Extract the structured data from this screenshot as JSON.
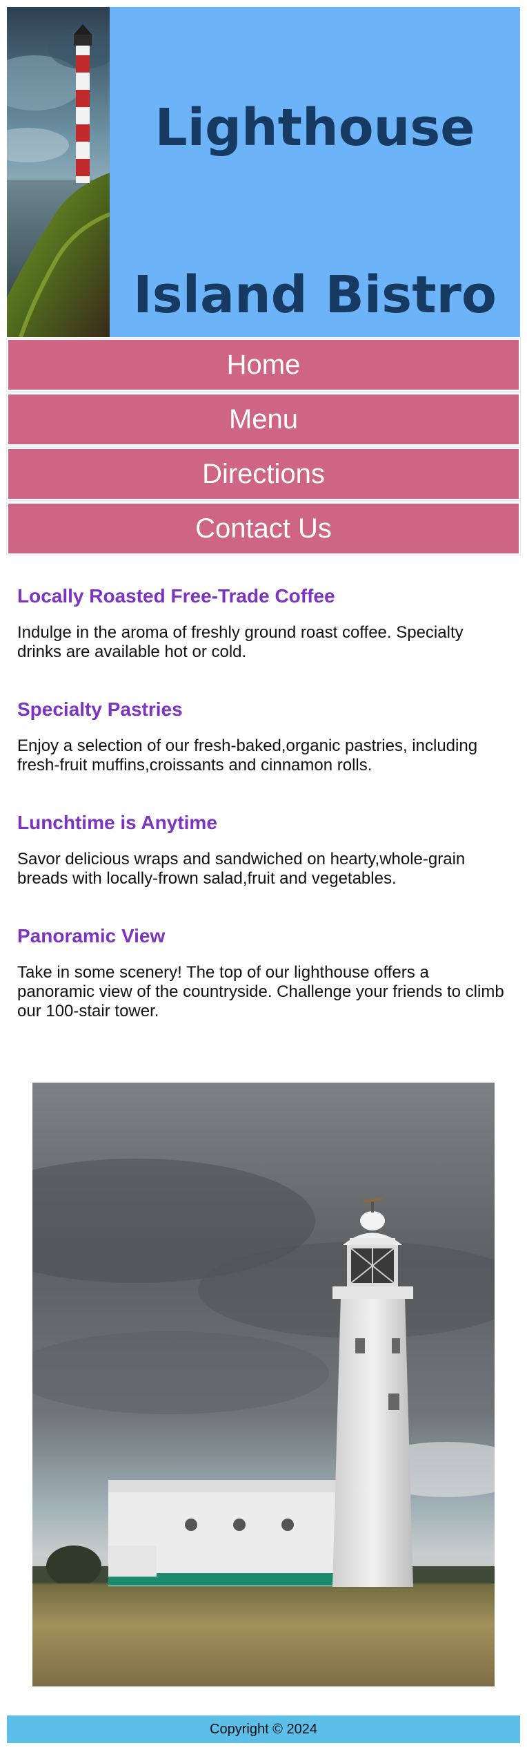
{
  "header": {
    "title_line1": "Lighthouse",
    "title_line2": "Island Bistro"
  },
  "nav": {
    "items": [
      {
        "label": "Home"
      },
      {
        "label": "Menu"
      },
      {
        "label": "Directions"
      },
      {
        "label": "Contact Us"
      }
    ]
  },
  "sections": [
    {
      "heading": "Locally Roasted Free-Trade Coffee",
      "text": "Indulge in the aroma of freshly ground roast coffee. Specialty drinks are available hot or cold."
    },
    {
      "heading": "Specialty Pastries",
      "text": "Enjoy a selection of our fresh-baked,organic pastries, including fresh-fruit muffins,croissants and cinnamon rolls."
    },
    {
      "heading": "Lunchtime is Anytime",
      "text": "Savor delicious wraps and sandwiched on hearty,whole-grain breads with locally-frown salad,fruit and vegetables."
    },
    {
      "heading": "Panoramic View",
      "text": "Take in some scenery! The top of our lighthouse offers a panoramic view of the countryside. Challenge your friends to climb our 100-stair tower."
    }
  ],
  "footer": {
    "copyright": "Copyright © 2024"
  },
  "colors": {
    "header_bg": "#6cb4f7",
    "title": "#163a61",
    "nav_bg": "#cf6584",
    "heading": "#7c34c0",
    "footer_bg": "#5bbfea"
  }
}
